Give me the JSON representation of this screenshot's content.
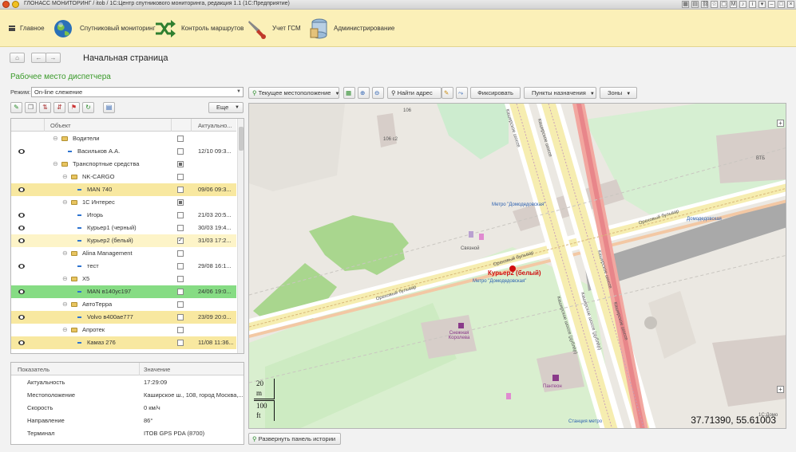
{
  "window": {
    "title": "ГЛОНАСС МОНИТОРИНГ / itob / 1С:Центр спутникового мониторинга, редакция 1.1 (1С:Предприятие)"
  },
  "menu": [
    {
      "label": "Главное",
      "icon": "hamburger-icon"
    },
    {
      "label": "Спутниковый мониторинг",
      "icon": "globe-icon"
    },
    {
      "label": "Контроль маршрутов",
      "icon": "shuffle-arrows-icon"
    },
    {
      "label": "Учет ГСМ",
      "icon": "fuel-pump-icon"
    },
    {
      "label": "Администрирование",
      "icon": "server-icon"
    }
  ],
  "page": {
    "title": "Начальная страница",
    "subtitle": "Рабочее место диспетчера"
  },
  "mode": {
    "label": "Режим:",
    "value": "On-line слежение"
  },
  "left_toolbar": {
    "more_label": "Еще"
  },
  "tree": {
    "columns": [
      "Объект",
      "Актуально..."
    ],
    "rows": [
      {
        "label": "Водители",
        "type": "folder",
        "level": 1,
        "eye": false,
        "check": "off",
        "date": "",
        "hl": "w"
      },
      {
        "label": "Васильков А.А.",
        "type": "item",
        "level": 2,
        "eye": true,
        "check": "off",
        "date": "12/10 09:3...",
        "hl": "w"
      },
      {
        "label": "Транспортные средства",
        "type": "folder",
        "level": 1,
        "eye": false,
        "check": "part",
        "date": "",
        "hl": "w"
      },
      {
        "label": "NK-CARGO",
        "type": "folder",
        "level": 2,
        "eye": false,
        "check": "off",
        "date": "",
        "hl": "w"
      },
      {
        "label": "MAN 740",
        "type": "item",
        "level": 3,
        "eye": true,
        "check": "off",
        "date": "09/06 09:3...",
        "hl": "y"
      },
      {
        "label": "1С Интерес",
        "type": "folder",
        "level": 2,
        "eye": false,
        "check": "part",
        "date": "",
        "hl": "w"
      },
      {
        "label": "Игорь",
        "type": "item",
        "level": 3,
        "eye": true,
        "check": "off",
        "date": "21/03 20:5...",
        "hl": "w"
      },
      {
        "label": "Курьер1 (черный)",
        "type": "item",
        "level": 3,
        "eye": true,
        "check": "off",
        "date": "30/03 19:4...",
        "hl": "w"
      },
      {
        "label": "Курьер2 (белый)",
        "type": "item",
        "level": 3,
        "eye": true,
        "check": "on",
        "date": "31/03 17:2...",
        "hl": "sel"
      },
      {
        "label": "Alina Management",
        "type": "folder",
        "level": 2,
        "eye": false,
        "check": "off",
        "date": "",
        "hl": "w"
      },
      {
        "label": "тест",
        "type": "item",
        "level": 3,
        "eye": true,
        "check": "off",
        "date": "29/08 16:1...",
        "hl": "w"
      },
      {
        "label": "Х5",
        "type": "folder",
        "level": 2,
        "eye": false,
        "check": "off",
        "date": "",
        "hl": "w"
      },
      {
        "label": "MAN в140ус197",
        "type": "item",
        "level": 3,
        "eye": true,
        "check": "off",
        "date": "24/06 19:0...",
        "hl": "g"
      },
      {
        "label": "АвтоТерра",
        "type": "folder",
        "level": 2,
        "eye": false,
        "check": "off",
        "date": "",
        "hl": "w"
      },
      {
        "label": "Volvo в400ае777",
        "type": "item",
        "level": 3,
        "eye": true,
        "check": "off",
        "date": "23/09 20:0...",
        "hl": "y"
      },
      {
        "label": "Апротек",
        "type": "folder",
        "level": 2,
        "eye": false,
        "check": "off",
        "date": "",
        "hl": "w"
      },
      {
        "label": "Камаз 276",
        "type": "item",
        "level": 3,
        "eye": true,
        "check": "off",
        "date": "11/08 11:36...",
        "hl": "y"
      }
    ]
  },
  "props": {
    "columns": [
      "Показатель",
      "Значение"
    ],
    "rows": [
      {
        "k": "Актуальность",
        "v": "17:29:09"
      },
      {
        "k": "Местоположение",
        "v": "Каширское ш., 108, город Москва,..."
      },
      {
        "k": "Скорость",
        "v": "0 км/ч"
      },
      {
        "k": "Направление",
        "v": "86°"
      },
      {
        "k": "Терминал",
        "v": "ITOB GPS PDA (8700)"
      }
    ]
  },
  "map_toolbar": {
    "location": "Текущее местоположение",
    "find": "Найти адрес",
    "fix": "Фиксировать",
    "dest": "Пункты назначения",
    "zones": "Зоны"
  },
  "map": {
    "coords": "37.71390, 55.61003",
    "marker_label": "Курьер2 (белый)",
    "scale_m_value": "20",
    "scale_m_unit": "m",
    "scale_ft_value": "100",
    "scale_ft_unit": "ft",
    "labels": {
      "orekhovy1": "Ореховый бульвар",
      "orekhovy2": "Ореховый бульвар",
      "orekhovy3": "Ореховый бульвар",
      "kashir1": "Каширское шоссе",
      "kashir2": "Каширское шоссе",
      "kashir3": "Каширское шоссе (дублёр)",
      "kashir4": "Каширское шоссе (дублёр)",
      "kashir5": "Каширское шоссе",
      "kashir6": "Каширское шоссе",
      "metro1": "Метро \"Домодедовская\"",
      "metro2": "Метро \"Домодедовская\"",
      "domod": "Домодедовская",
      "svyaznoy": "Связной",
      "snow": "Снежная Королева",
      "pantheon": "Пантеон",
      "station": "Станция метро",
      "vtb": "ВТБ",
      "num106": "106",
      "num106a": "106 с2",
      "copyright": "1С:Домо"
    }
  },
  "history_button": "Развернуть панель истории"
}
